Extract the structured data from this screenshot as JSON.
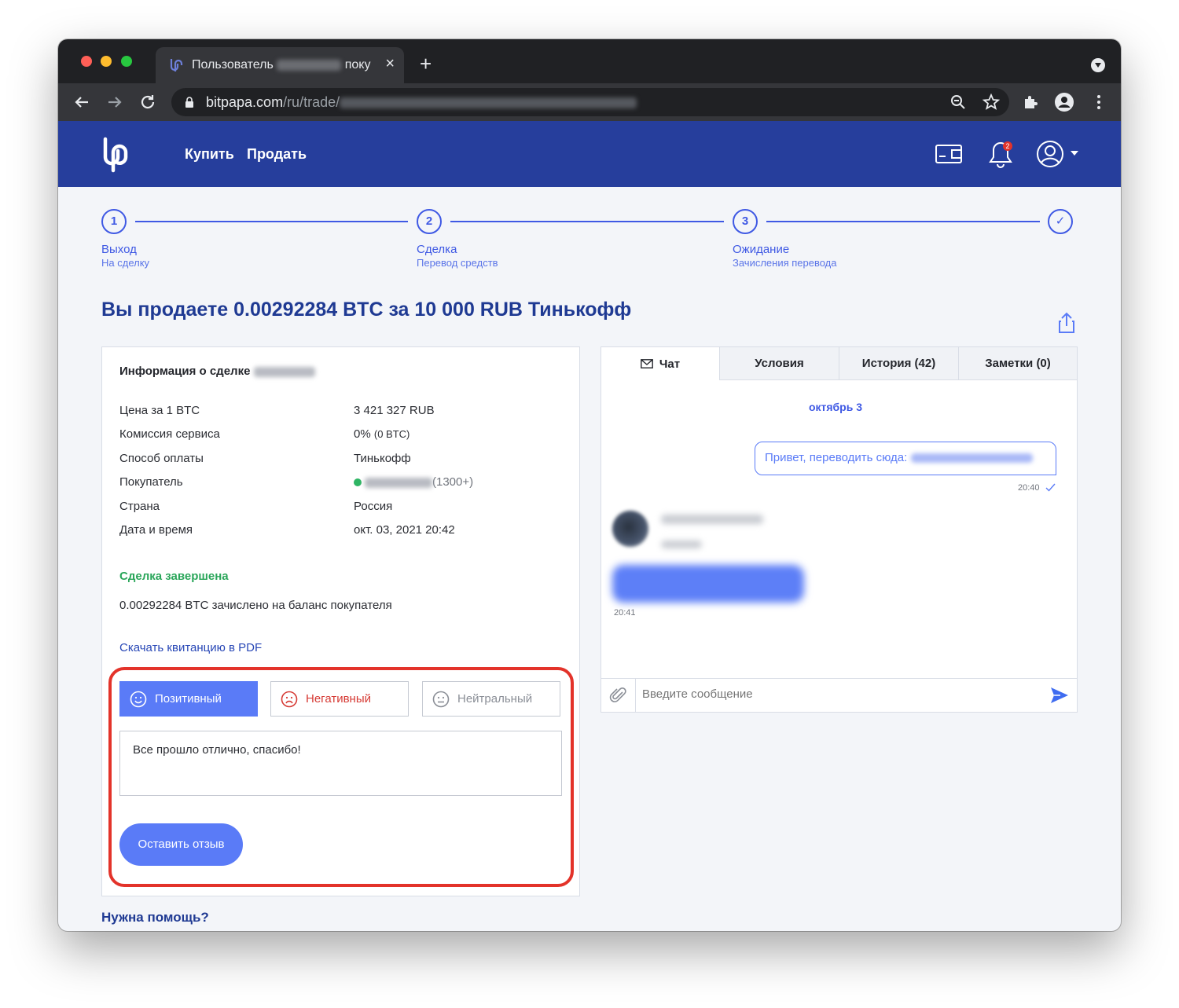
{
  "browser": {
    "tab_title_prefix": "Пользователь",
    "tab_title_suffix": "поку",
    "tab_close": "×",
    "new_tab": "+",
    "url_domain": "bitpapa.com",
    "url_path": "/ru/trade/"
  },
  "header": {
    "nav": [
      {
        "label": "Купить"
      },
      {
        "label": "Продать"
      }
    ],
    "notification_count": "2"
  },
  "stepper": {
    "steps": [
      {
        "number": "1",
        "title": "Выход",
        "subtitle": "На сделку"
      },
      {
        "number": "2",
        "title": "Сделка",
        "subtitle": "Перевод средств"
      },
      {
        "number": "3",
        "title": "Ожидание",
        "subtitle": "Зачисления перевода"
      }
    ],
    "final": "✓"
  },
  "page": {
    "title": "Вы продаете 0.00292284 BTC за 10 000 RUB Тинькофф"
  },
  "deal_info": {
    "heading": "Информация о сделке",
    "rows": [
      {
        "label": "Цена за 1 BTC",
        "value": "3 421 327 RUB"
      },
      {
        "label": "Комиссия сервиса",
        "value": "0%",
        "value_small": "(0 BTC)"
      },
      {
        "label": "Способ оплаты",
        "value": "Тинькофф"
      },
      {
        "label": "Покупатель",
        "value": "(1300+)"
      },
      {
        "label": "Страна",
        "value": "Россия"
      },
      {
        "label": "Дата и время",
        "value": "окт. 03, 2021 20:42"
      }
    ],
    "status_title": "Сделка завершена",
    "status_text": "0.00292284 BTC зачислено на баланс покупателя",
    "pdf_link": "Скачать квитанцию в PDF"
  },
  "feedback": {
    "positive": "Позитивный",
    "negative": "Негативный",
    "neutral": "Нейтральный",
    "text": "Все прошло отлично, спасибо!",
    "submit": "Оставить отзыв"
  },
  "help": {
    "label": "Нужна помощь?"
  },
  "chat": {
    "tabs": [
      {
        "label": "Чат"
      },
      {
        "label": "Условия"
      },
      {
        "label": "История (42)"
      },
      {
        "label": "Заметки (0)"
      }
    ],
    "date": "октябрь 3",
    "outgoing_text": "Привет, переводить сюда:",
    "outgoing_time": "20:40",
    "incoming_time": "20:41",
    "input_placeholder": "Введите сообщение"
  },
  "colors": {
    "brand_header": "#263e9c",
    "accent": "#3f59e4",
    "button": "#5a7bf7",
    "success": "#2aa65a",
    "negative": "#d63a34",
    "highlight": "#e3332a"
  }
}
